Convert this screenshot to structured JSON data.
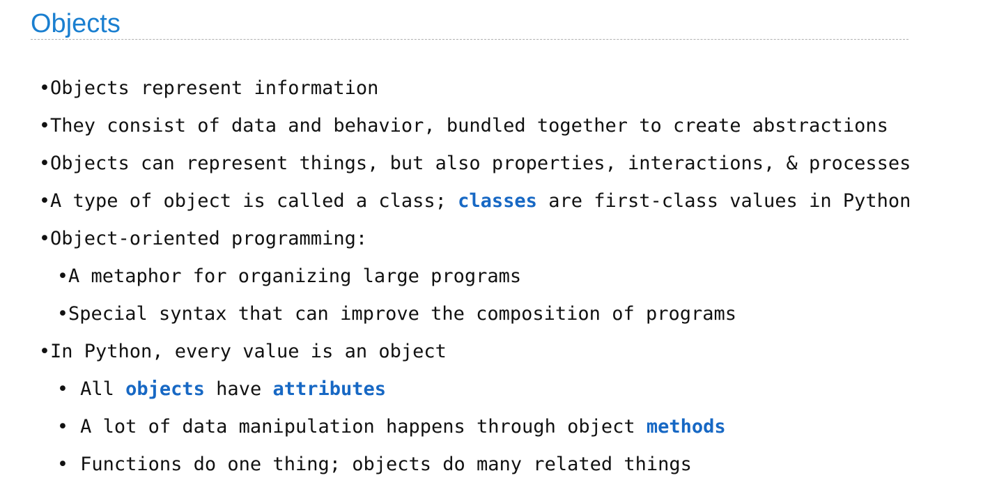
{
  "slide": {
    "title": "Objects",
    "bullets": [
      {
        "text": "Objects represent information"
      },
      {
        "text": "They consist of data and behavior, bundled together to create abstractions"
      },
      {
        "text": "Objects can represent things, but also properties, interactions, & processes"
      },
      {
        "pre": "A type of object is called a class; ",
        "hl": "classes",
        "post": " are first-class values in Python"
      },
      {
        "text": "Object-oriented programming:"
      },
      {
        "text": "A metaphor for organizing large programs"
      },
      {
        "text": "Special syntax that can improve the composition of programs"
      },
      {
        "text": "In Python, every value is an object"
      },
      {
        "pre": "All ",
        "hl1": "objects",
        "mid": " have ",
        "hl2": "attributes"
      },
      {
        "pre": "A lot of data manipulation happens through object ",
        "hl": "methods"
      },
      {
        "text": "Functions do one thing; objects do many related things"
      }
    ]
  },
  "colors": {
    "title": "#1a7fd0",
    "highlight": "#1768c4",
    "text": "#111111"
  }
}
